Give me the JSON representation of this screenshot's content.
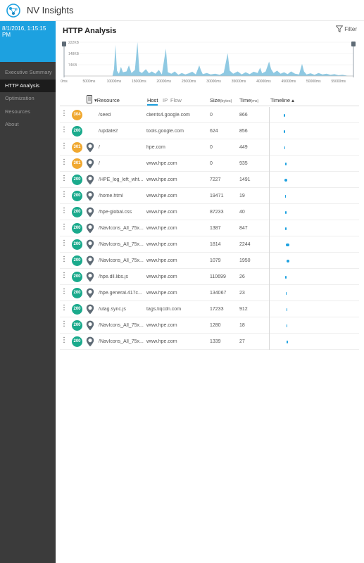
{
  "app": {
    "title": "NV Insights"
  },
  "sidebar": {
    "datetime": "8/1/2016, 1:15:15 PM",
    "items": [
      {
        "label": "Executive Summary",
        "active": false
      },
      {
        "label": "HTTP Analysis",
        "active": true
      },
      {
        "label": "Optimization",
        "active": false
      },
      {
        "label": "Resources",
        "active": false
      },
      {
        "label": "About",
        "active": false
      }
    ]
  },
  "page": {
    "title": "HTTP Analysis",
    "filter_label": "Filter"
  },
  "colors": {
    "accent": "#1da1e0",
    "status_200": "#1aaa8c",
    "status_30x": "#f0a830",
    "chart_fill": "#8fc9e2"
  },
  "chart_data": {
    "type": "area",
    "y_tick_labels": [
      "222KB",
      "148KB",
      "74KB"
    ],
    "y_ticks": [
      222,
      148,
      74
    ],
    "ylim": [
      0,
      222
    ],
    "x_tick_labels": [
      "0ms",
      "5000ms",
      "10000ms",
      "15000ms",
      "20000ms",
      "25000ms",
      "30000ms",
      "35000ms",
      "40000ms",
      "45000ms",
      "50000ms",
      "55000ms"
    ],
    "xlim": [
      0,
      58000
    ],
    "points": [
      [
        9700,
        0
      ],
      [
        10000,
        45
      ],
      [
        10300,
        205
      ],
      [
        10600,
        35
      ],
      [
        11000,
        15
      ],
      [
        11400,
        60
      ],
      [
        11800,
        25
      ],
      [
        12500,
        30
      ],
      [
        13000,
        70
      ],
      [
        13500,
        20
      ],
      [
        14200,
        40
      ],
      [
        14700,
        222
      ],
      [
        15100,
        30
      ],
      [
        15600,
        20
      ],
      [
        16400,
        45
      ],
      [
        17000,
        18
      ],
      [
        17600,
        30
      ],
      [
        18300,
        15
      ],
      [
        19000,
        40
      ],
      [
        19600,
        10
      ],
      [
        20400,
        180
      ],
      [
        20800,
        25
      ],
      [
        21500,
        15
      ],
      [
        22200,
        30
      ],
      [
        22900,
        8
      ],
      [
        23600,
        20
      ],
      [
        24300,
        10
      ],
      [
        25000,
        18
      ],
      [
        25700,
        28
      ],
      [
        26400,
        10
      ],
      [
        27100,
        70
      ],
      [
        27400,
        40
      ],
      [
        27800,
        12
      ],
      [
        28600,
        20
      ],
      [
        29400,
        10
      ],
      [
        30300,
        15
      ],
      [
        31200,
        8
      ],
      [
        32000,
        22
      ],
      [
        32800,
        150
      ],
      [
        33200,
        35
      ],
      [
        33900,
        15
      ],
      [
        34800,
        30
      ],
      [
        35600,
        10
      ],
      [
        36400,
        25
      ],
      [
        37200,
        12
      ],
      [
        38000,
        28
      ],
      [
        38800,
        20
      ],
      [
        39300,
        55
      ],
      [
        39700,
        18
      ],
      [
        40400,
        30
      ],
      [
        41100,
        95
      ],
      [
        41500,
        45
      ],
      [
        42000,
        20
      ],
      [
        42700,
        35
      ],
      [
        43400,
        15
      ],
      [
        44100,
        25
      ],
      [
        44800,
        12
      ],
      [
        45500,
        30
      ],
      [
        46300,
        15
      ],
      [
        47100,
        10
      ],
      [
        47700,
        80
      ],
      [
        48100,
        30
      ],
      [
        48600,
        10
      ],
      [
        49400,
        18
      ],
      [
        50200,
        8
      ],
      [
        51000,
        20
      ],
      [
        51800,
        10
      ],
      [
        52600,
        15
      ],
      [
        53400,
        8
      ],
      [
        54200,
        12
      ],
      [
        55000,
        5
      ],
      [
        55800,
        8
      ],
      [
        56800,
        2
      ],
      [
        58000,
        0
      ]
    ]
  },
  "table": {
    "columns": {
      "resource": "Resource",
      "host_tab": "Host",
      "ip_tab": "IP",
      "flow_tab": "Flow",
      "size": "Size",
      "size_unit": "(bytes)",
      "time": "Time",
      "time_unit": "(ms)",
      "timeline": "Timeline",
      "sort_indicator": "▴"
    },
    "timeline_max_ms": 60000,
    "rows": [
      {
        "status": "304",
        "has_pin": false,
        "resource": "/seed",
        "host": "clients4.google.com",
        "size": "0",
        "time": "866",
        "tl_start": 9300,
        "tl_dur": 866
      },
      {
        "status": "200",
        "has_pin": false,
        "resource": "/update2",
        "host": "tools.google.com",
        "size": "624",
        "time": "856",
        "tl_start": 9400,
        "tl_dur": 856
      },
      {
        "status": "301",
        "has_pin": true,
        "resource": "/",
        "host": "hpe.com",
        "size": "0",
        "time": "449",
        "tl_start": 9700,
        "tl_dur": 449
      },
      {
        "status": "301",
        "has_pin": true,
        "resource": "/",
        "host": "www.hpe.com",
        "size": "0",
        "time": "935",
        "tl_start": 10000,
        "tl_dur": 935
      },
      {
        "status": "200",
        "has_pin": true,
        "resource": "/HPE_log_left_wht...",
        "host": "www.hpe.com",
        "size": "7227",
        "time": "1491",
        "tl_start": 9900,
        "tl_dur": 1491
      },
      {
        "status": "200",
        "has_pin": true,
        "resource": "/home.html",
        "host": "www.hpe.com",
        "size": "19471",
        "time": "19",
        "tl_start": 10300,
        "tl_dur": 19
      },
      {
        "status": "200",
        "has_pin": true,
        "resource": "/hpe-global.css",
        "host": "www.hpe.com",
        "size": "87233",
        "time": "40",
        "tl_start": 10400,
        "tl_dur": 40
      },
      {
        "status": "200",
        "has_pin": true,
        "resource": "/NavIcons_All_75x...",
        "host": "www.hpe.com",
        "size": "1387",
        "time": "847",
        "tl_start": 10300,
        "tl_dur": 847
      },
      {
        "status": "200",
        "has_pin": true,
        "resource": "/NavIcons_All_75x...",
        "host": "www.hpe.com",
        "size": "1814",
        "time": "2244",
        "tl_start": 10800,
        "tl_dur": 2244
      },
      {
        "status": "200",
        "has_pin": true,
        "resource": "/NavIcons_All_75x...",
        "host": "www.hpe.com",
        "size": "1079",
        "time": "1950",
        "tl_start": 11200,
        "tl_dur": 1950
      },
      {
        "status": "200",
        "has_pin": true,
        "resource": "/hpe.dll.libs.js",
        "host": "www.hpe.com",
        "size": "110699",
        "time": "26",
        "tl_start": 10400,
        "tl_dur": 26
      },
      {
        "status": "200",
        "has_pin": true,
        "resource": "/hpe.general.417c...",
        "host": "www.hpe.com",
        "size": "134067",
        "time": "23",
        "tl_start": 10500,
        "tl_dur": 23
      },
      {
        "status": "200",
        "has_pin": true,
        "resource": "/utag.sync.js",
        "host": "tags.tiqcdn.com",
        "size": "17233",
        "time": "912",
        "tl_start": 10900,
        "tl_dur": 912
      },
      {
        "status": "200",
        "has_pin": true,
        "resource": "/NavIcons_All_75x...",
        "host": "www.hpe.com",
        "size": "1280",
        "time": "18",
        "tl_start": 11100,
        "tl_dur": 18
      },
      {
        "status": "200",
        "has_pin": true,
        "resource": "/NavIcons_All_75x...",
        "host": "www.hpe.com",
        "size": "1339",
        "time": "27",
        "tl_start": 11300,
        "tl_dur": 27
      }
    ]
  }
}
